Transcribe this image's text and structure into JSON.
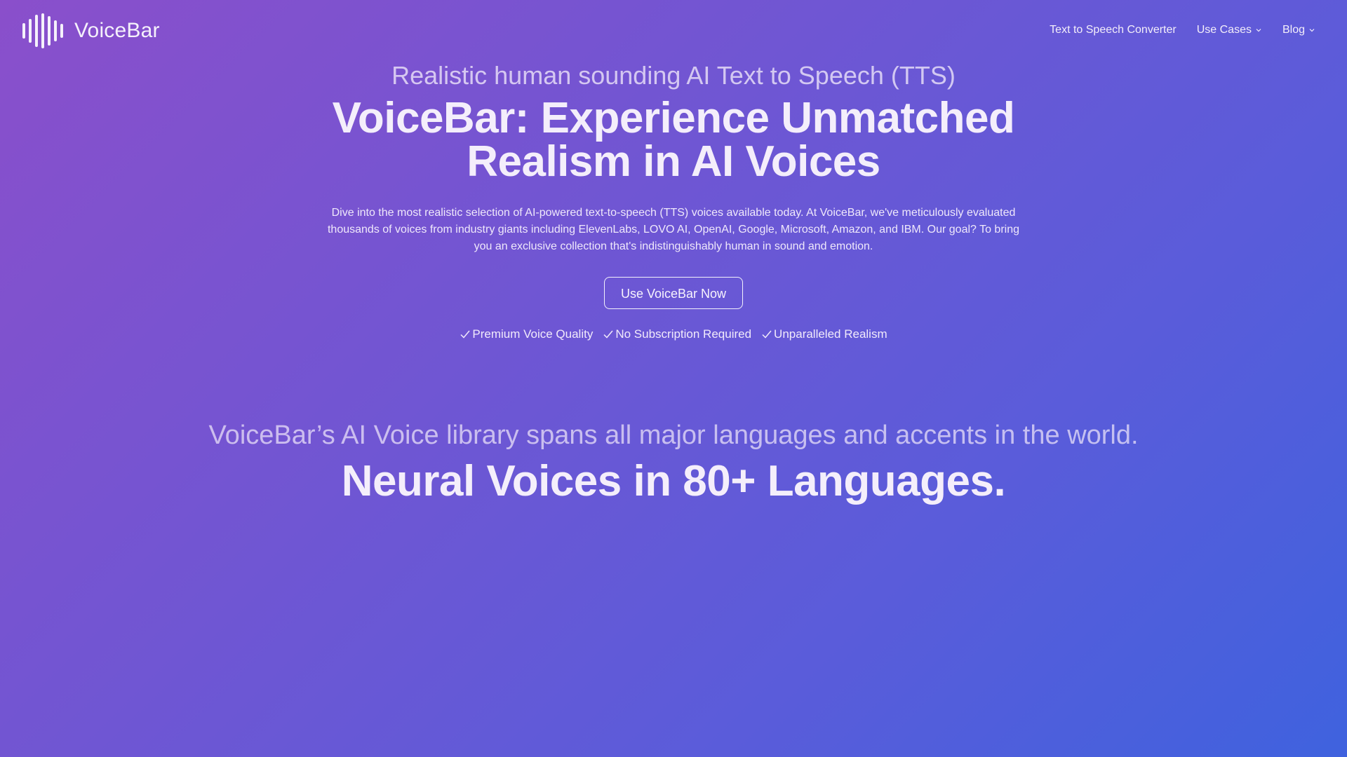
{
  "brand": {
    "name": "VoiceBar"
  },
  "nav": {
    "items": [
      {
        "label": "Text to Speech Converter",
        "has_dropdown": false
      },
      {
        "label": "Use Cases",
        "has_dropdown": true
      },
      {
        "label": "Blog",
        "has_dropdown": true
      }
    ]
  },
  "hero": {
    "kicker": "Realistic human sounding AI Text to Speech (TTS)",
    "title": "VoiceBar: Experience Unmatched Realism in AI Voices",
    "description": "Dive into the most realistic selection of AI-powered text-to-speech (TTS) voices available today. At VoiceBar, we've meticulously evaluated thousands of voices from industry giants including ElevenLabs, LOVO AI, OpenAI, Google, Microsoft, Amazon, and IBM. Our goal? To bring you an exclusive collection that's indistinguishably human in sound and emotion.",
    "cta_label": "Use VoiceBar Now",
    "features": [
      "Premium Voice Quality",
      "No Subscription Required",
      "Unparalleled Realism"
    ]
  },
  "languages": {
    "kicker": "VoiceBar’s AI Voice library spans all major languages and accents in the world.",
    "title": "Neural Voices in 80+ Languages."
  },
  "icons": {
    "logo": "sound-wave-icon",
    "dropdown": "chevron-down-icon",
    "feature": "check-icon"
  },
  "colors": {
    "gradient_start": "#8a4fcb",
    "gradient_end": "#3f62de",
    "text": "#f3eefa"
  }
}
